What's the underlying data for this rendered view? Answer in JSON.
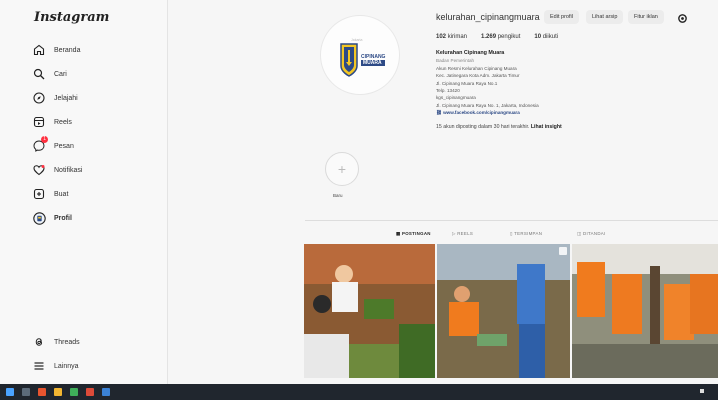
{
  "app": {
    "logo": "Instagram"
  },
  "sidebar": {
    "items": [
      {
        "label": "Beranda",
        "icon": "home-icon"
      },
      {
        "label": "Cari",
        "icon": "search-icon"
      },
      {
        "label": "Jelajahi",
        "icon": "compass-icon"
      },
      {
        "label": "Reels",
        "icon": "reels-icon"
      },
      {
        "label": "Pesan",
        "icon": "messenger-icon",
        "badge": "1"
      },
      {
        "label": "Notifikasi",
        "icon": "heart-icon"
      },
      {
        "label": "Buat",
        "icon": "plus-square-icon"
      },
      {
        "label": "Profil",
        "icon": "avatar-icon"
      }
    ],
    "bottom_items": [
      {
        "label": "Threads",
        "icon": "threads-icon"
      },
      {
        "label": "Lainnya",
        "icon": "menu-icon"
      }
    ]
  },
  "profile": {
    "username": "kelurahan_cipinangmuara",
    "buttons": {
      "edit": "Edit profil",
      "archive": "Lihat arsip",
      "ads": "Fitur iklan"
    },
    "stats": [
      {
        "count": "102",
        "label": "kiriman"
      },
      {
        "count": "1.269",
        "label": "pengikut"
      },
      {
        "count": "10",
        "label": "diikuti"
      }
    ],
    "bio": {
      "name": "Kelurahan Cipinang Muara",
      "category": "Badan Pemerintah",
      "lines": [
        "Akun Resmi Kelurahan Cipinang Muara",
        "Kec. Jatinegara Kota Adm. Jakarta Timur",
        "Jl. Cipinang Muara Raya No.1",
        "Telp. 13420",
        "kgs_cipinangmuara",
        "Jl. Cipinang Muara Raya No. 1, Jakarta, Indonesia"
      ],
      "link": "www.facebook.com/cipinangmuara"
    },
    "followed_text": "15 akun diposting dalam 30 hari terakhir.",
    "insight": "Lihat insight",
    "logo_text": [
      "CIPINANG",
      "MUARA"
    ],
    "logo_top": "Jakarta"
  },
  "highlight": {
    "label": "Baru"
  },
  "tabs": [
    "POSTINGAN",
    "REELS",
    "TERSIMPAN",
    "DITANDAI"
  ],
  "colors": {
    "accent": "#2d4a86",
    "taskbar": "#20262e",
    "badge": "#ff3040"
  }
}
